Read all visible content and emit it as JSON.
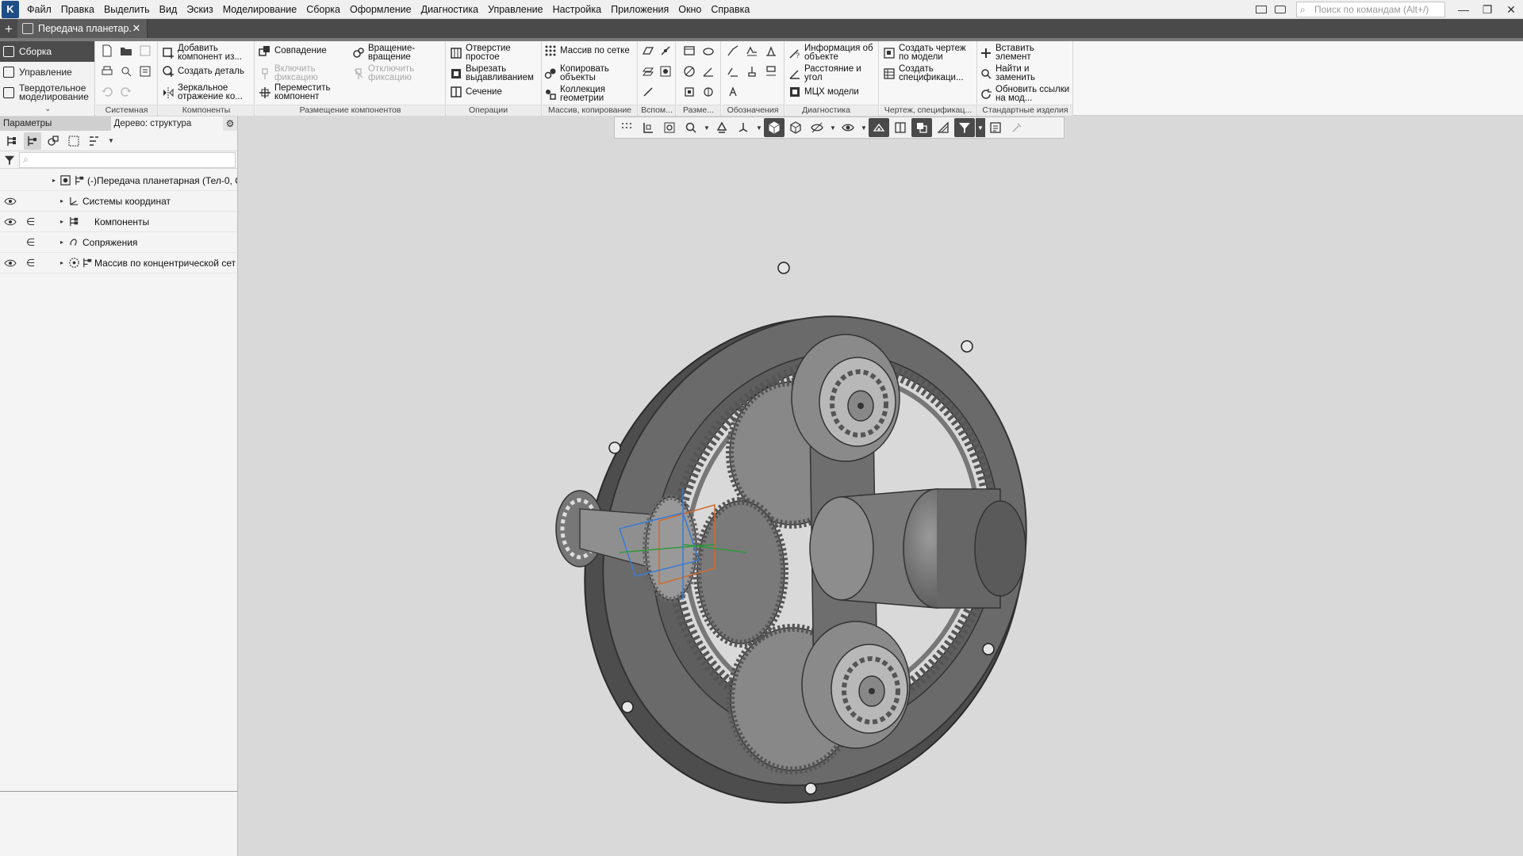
{
  "menu": {
    "items": [
      "Файл",
      "Правка",
      "Выделить",
      "Вид",
      "Эскиз",
      "Моделирование",
      "Сборка",
      "Оформление",
      "Диагностика",
      "Управление",
      "Настройка",
      "Приложения",
      "Окно",
      "Справка"
    ],
    "search_placeholder": "Поиск по командам (Alt+/)"
  },
  "tabs": {
    "active_title": "Передача планетар..."
  },
  "modes": {
    "assembly": "Сборка",
    "management": "Управление",
    "solid": "Твердотельное моделирование"
  },
  "ribbon": {
    "groups": {
      "system": "Системная",
      "components": "Компоненты",
      "placement": "Размещение компонентов",
      "operations": "Операции",
      "array": "Массив, копирование",
      "aux": "Вспом...",
      "dims": "Разме...",
      "notation": "Обозначения",
      "diagnostics": "Диагностика",
      "drawing": "Чертеж, спецификац...",
      "standard": "Стандартные изделия"
    },
    "commands": {
      "add_component": "Добавить компонент из...",
      "create_part": "Создать деталь",
      "mirror": "Зеркальное отражение ко...",
      "coincidence": "Совпадение",
      "enable_fix": "Включить фиксацию",
      "move_component": "Переместить компонент",
      "rotation": "Вращение-вращение",
      "disable_fix": "Отключить фиксацию",
      "hole_simple": "Отверстие простое",
      "cut_extrude": "Вырезать выдавливанием",
      "section": "Сечение",
      "grid_array": "Массив по сетке",
      "copy_objects": "Копировать объекты",
      "geometry_collection": "Коллекция геометрии",
      "object_info": "Информация об объекте",
      "distance_angle": "Расстояние и угол",
      "mass_props": "МЦХ модели",
      "create_drawing": "Создать чертеж по модели",
      "create_spec": "Создать спецификаци...",
      "insert_element": "Вставить элемент",
      "find_replace": "Найти и заменить",
      "update_links": "Обновить ссылки на мод..."
    }
  },
  "left_panel": {
    "tab_params": "Параметры",
    "tab_tree": "Дерево: структура",
    "rows": [
      {
        "label": "(-)Передача планетарная (Тел-0, С"
      },
      {
        "label": "Системы координат"
      },
      {
        "label": "Компоненты"
      },
      {
        "label": "Сопряжения"
      },
      {
        "label": "Массив по концентрической сет"
      }
    ]
  },
  "colors": {
    "accent": "#1f4e86",
    "tab_dark": "#4a4a4a",
    "viewport_bg": "#d9d9d9",
    "model_gray": "#6a6a6a"
  }
}
